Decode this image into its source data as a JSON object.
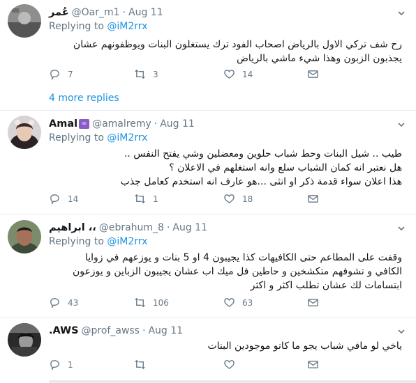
{
  "tweets": [
    {
      "name": "عُمر",
      "handle": "@Oar_m1",
      "dot": "·",
      "date": "Aug 11",
      "replying_prefix": "Replying to",
      "mention": "@iM2rrx",
      "lines": [
        "رح شف تركي الاول بالرياض اصحاب الفود ترك يستغلون البنات ويوظفونهم عشان",
        "يجذبون الزبون وهذا شيء ماشي بالرياض"
      ],
      "replies": "7",
      "retweets": "3",
      "likes": "14",
      "more_replies": "4 more replies"
    },
    {
      "name": "Amal",
      "handle": "@amalremy",
      "dot": "·",
      "date": "Aug 11",
      "replying_prefix": "Replying to",
      "mention": "@iM2rrx",
      "lines": [
        "طيب .. شيل البنات وحط شباب حلوين ومعضلين وشي يفتح النفس ..",
        "هل نعتبر انه كمان الشباب سلع وانه استغلهم في الاعلان ؟",
        "هذا اعلان سواء قدمة ذكر او انثى ...هو عارف انه استخدم كعامل جذب"
      ],
      "replies": "14",
      "retweets": "1",
      "likes": "18"
    },
    {
      "name": "ابراهيم ،،",
      "handle": "@ebrahum_8",
      "dot": "·",
      "date": "Aug 11",
      "replying_prefix": "Replying to",
      "mention": "@iM2rrx",
      "lines": [
        "وقفت على المطاعم حتى الكافيهات كذا يجيبون 4 او 5 بنات و يوزعهم في زوايا",
        "الكافي و تشوفهم متكشخين و حاطين فل ميك اب عشان يجيبون الزباين و يوزعون",
        "ابتسامات لك عشان تطلب اكثر و اكثر"
      ],
      "replies": "43",
      "retweets": "106",
      "likes": "63"
    },
    {
      "name": ".AWS",
      "handle": "@prof_awss",
      "dot": "·",
      "date": "Aug 11",
      "lines": [
        "ياخي لو مافي شباب يجو ما كانو موجودين البنات"
      ],
      "replies": "1",
      "retweets": "",
      "likes": ""
    }
  ],
  "colors": {
    "link": "#1b95e0",
    "muted": "#657786",
    "divider": "#e6ecf0",
    "badge": "#8a5cc7"
  }
}
